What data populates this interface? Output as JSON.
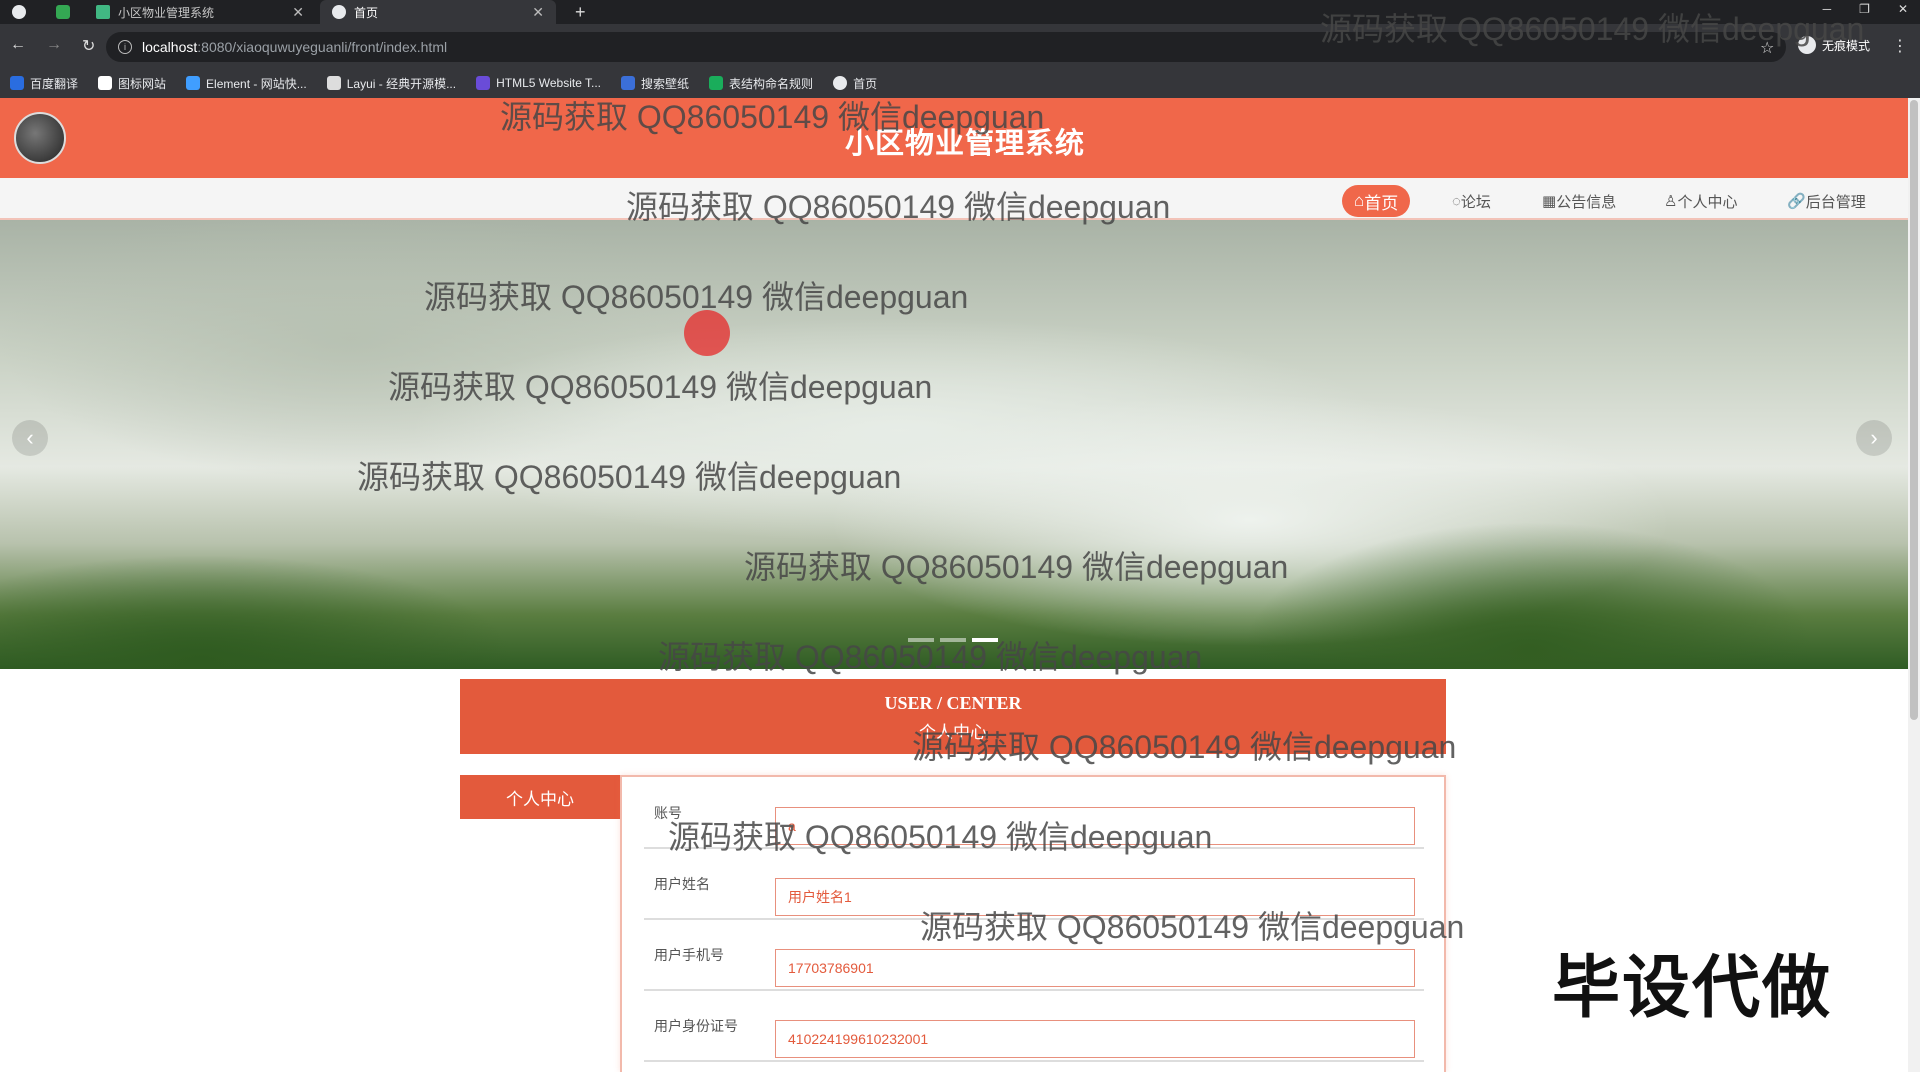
{
  "browser": {
    "tabs": [
      {
        "label": "小区物业管理系统"
      },
      {
        "label": "首页"
      }
    ],
    "url_host": "localhost",
    "url_path": ":8080/xiaoquwuyeguanli/front/index.html",
    "profile_label": "无痕模式",
    "bookmarks": [
      "百度翻译",
      "图标网站",
      "Element - 网站快...",
      "Layui - 经典开源模...",
      "HTML5 Website T...",
      "搜索壁纸",
      "表结构命名规则",
      "首页"
    ]
  },
  "site": {
    "title": "小区物业管理系统",
    "nav": [
      {
        "label": "首页"
      },
      {
        "label": "论坛"
      },
      {
        "label": "公告信息"
      },
      {
        "label": "个人中心"
      },
      {
        "label": "后台管理"
      }
    ]
  },
  "center": {
    "title_en": "USER / CENTER",
    "title_cn": "个人中心",
    "side_tab": "个人中心"
  },
  "form": {
    "fields": [
      {
        "label": "账号",
        "value": "a"
      },
      {
        "label": "用户姓名",
        "value": "用户姓名1"
      },
      {
        "label": "用户手机号",
        "value": "17703786901"
      },
      {
        "label": "用户身份证号",
        "value": "410224199610232001"
      }
    ]
  },
  "overlay": {
    "watermark": "源码获取 QQ86050149 微信deepguan",
    "promo": "毕设代做"
  },
  "colors": {
    "accent": "#f0674a",
    "accent_dark": "#e35a3c"
  }
}
